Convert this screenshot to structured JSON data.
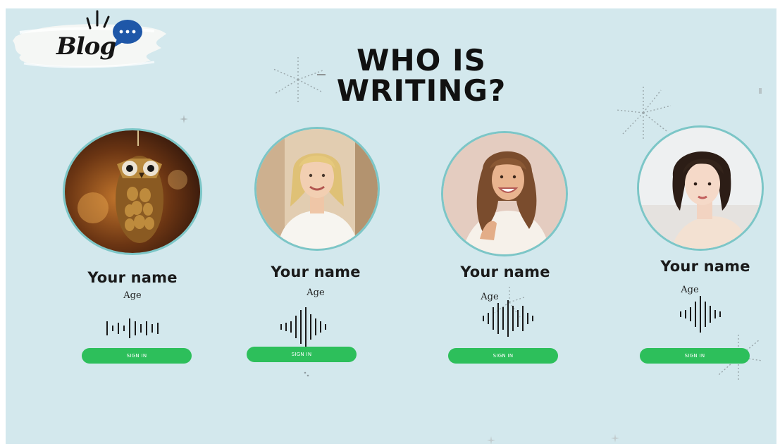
{
  "logo": {
    "text": "Blog",
    "chat_icon": "speech-bubble-icon"
  },
  "heading": {
    "line1": "WHO IS",
    "line2": "WRITING?"
  },
  "profiles": [
    {
      "name": "Your name",
      "age_label": "Age",
      "button_label": "SIGN IN",
      "image": "owl-ornament-photo"
    },
    {
      "name": "Your name",
      "age_label": "Age",
      "button_label": "SIGN IN",
      "image": "blonde-woman-photo"
    },
    {
      "name": "Your name",
      "age_label": "Age",
      "button_label": "SIGN IN",
      "image": "curly-hair-woman-photo"
    },
    {
      "name": "Your name",
      "age_label": "Age",
      "button_label": "SIGN IN",
      "image": "short-hair-woman-photo"
    }
  ],
  "colors": {
    "background": "#d3e8ed",
    "accent_green": "#2dbf5b",
    "portrait_ring": "#7cc6c7",
    "chat_bubble": "#1e57a8"
  }
}
